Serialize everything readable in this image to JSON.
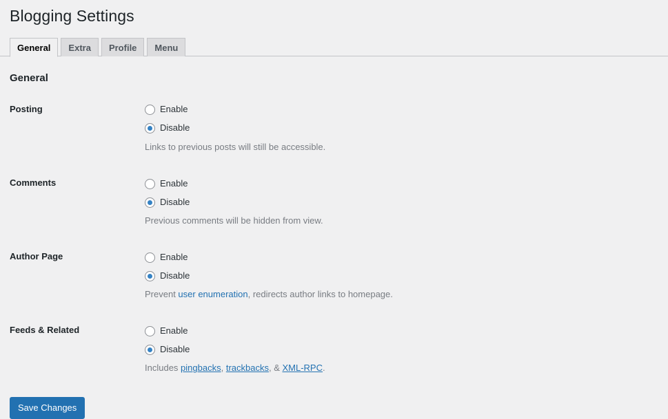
{
  "header": {
    "title": "Blogging Settings"
  },
  "tabs": [
    {
      "label": "General",
      "active": true
    },
    {
      "label": "Extra",
      "active": false
    },
    {
      "label": "Profile",
      "active": false
    },
    {
      "label": "Menu",
      "active": false
    }
  ],
  "section": {
    "heading": "General"
  },
  "options": {
    "enable_label": "Enable",
    "disable_label": "Disable"
  },
  "rows": [
    {
      "label": "Posting",
      "selected": "Disable",
      "description_prefix": "Links to previous posts will still be accessible.",
      "links": []
    },
    {
      "label": "Comments",
      "selected": "Disable",
      "description_prefix": "Previous comments will be hidden from view.",
      "links": []
    },
    {
      "label": "Author Page",
      "selected": "Disable",
      "description_prefix": "Prevent ",
      "link1": "user enumeration",
      "description_mid": ", redirects author links to homepage.",
      "links": [
        "user enumeration"
      ]
    },
    {
      "label": "Feeds & Related",
      "selected": "Disable",
      "description_prefix": "Includes ",
      "link1": "pingbacks",
      "sep1": ", ",
      "link2": "trackbacks",
      "sep2": ", & ",
      "link3": "XML-RPC",
      "suffix": ".",
      "links": [
        "pingbacks",
        "trackbacks",
        "XML-RPC"
      ]
    }
  ],
  "submit": {
    "save_label": "Save Changes"
  },
  "colors": {
    "background": "#f0f0f1",
    "accent": "#2271b1",
    "radio_accent": "#3582c4",
    "border": "#c3c4c7",
    "tab_inactive": "#dcdcde",
    "description_text": "#787c82"
  }
}
